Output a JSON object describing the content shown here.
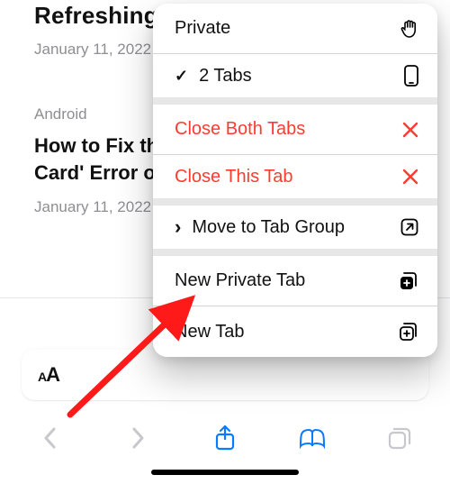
{
  "background": {
    "article1_title": "Refreshing? How to Fix",
    "article1_date": "January 11, 2022",
    "article2_category": "Android",
    "article2_title_line1": "How to Fix the 'No SIM",
    "article2_title_line2": "Card' Error on Android",
    "article2_date": "January 11, 2022"
  },
  "menu": {
    "private": "Private",
    "tabs_prefix_checked": "✓",
    "tabs_label": "2 Tabs",
    "close_both": "Close Both Tabs",
    "close_this": "Close This Tab",
    "move_prefix": "›",
    "move_label": "Move to Tab Group",
    "new_private": "New Private Tab",
    "new_tab": "New Tab"
  },
  "urlbar": {
    "aa_small": "A",
    "aa_big": "A"
  }
}
